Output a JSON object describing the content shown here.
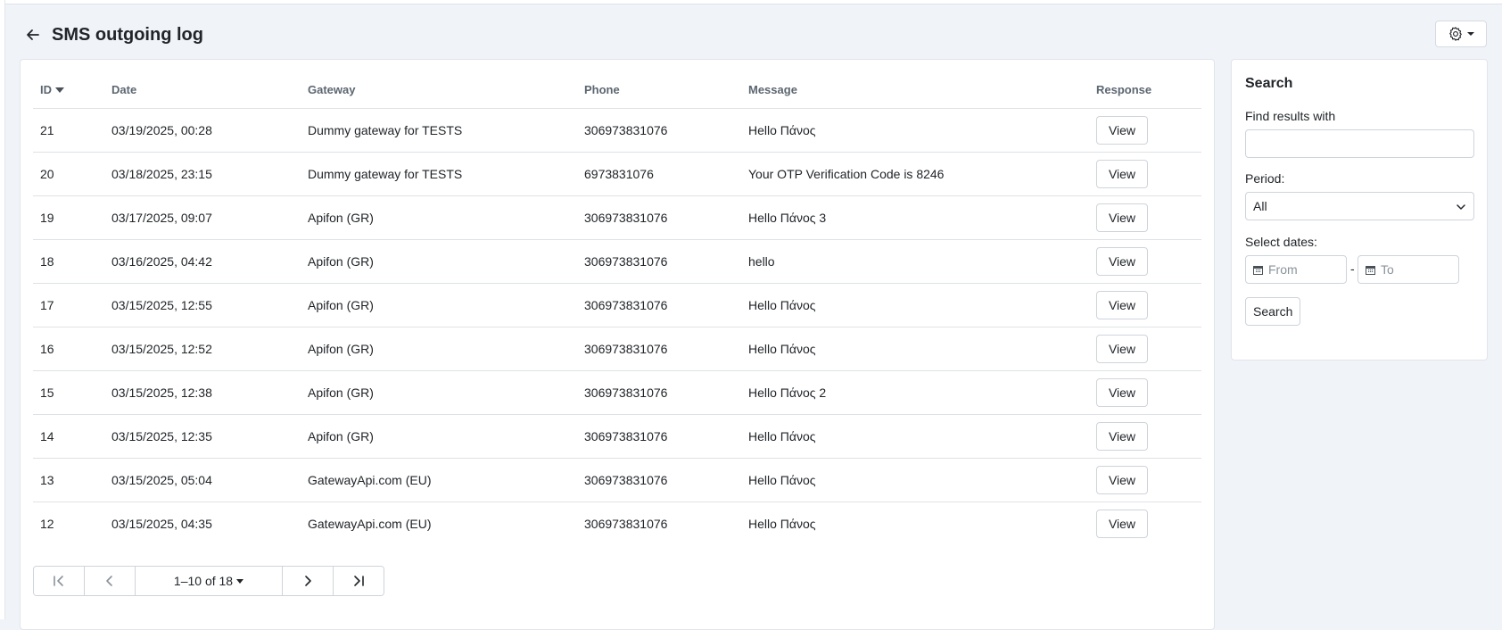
{
  "header": {
    "title": "SMS outgoing log"
  },
  "table": {
    "columns": {
      "id": "ID",
      "date": "Date",
      "gateway": "Gateway",
      "phone": "Phone",
      "message": "Message",
      "response": "Response"
    },
    "rows": [
      {
        "id": "21",
        "date": "03/19/2025, 00:28",
        "gateway": "Dummy gateway for TESTS",
        "phone": "306973831076",
        "message": "Hello Πάνος",
        "action": "View"
      },
      {
        "id": "20",
        "date": "03/18/2025, 23:15",
        "gateway": "Dummy gateway for TESTS",
        "phone": "6973831076",
        "message": "Your OTP Verification Code is 8246",
        "action": "View"
      },
      {
        "id": "19",
        "date": "03/17/2025, 09:07",
        "gateway": "Apifon (GR)",
        "phone": "306973831076",
        "message": "Hello Πάνος 3",
        "action": "View"
      },
      {
        "id": "18",
        "date": "03/16/2025, 04:42",
        "gateway": "Apifon (GR)",
        "phone": "306973831076",
        "message": "hello",
        "action": "View"
      },
      {
        "id": "17",
        "date": "03/15/2025, 12:55",
        "gateway": "Apifon (GR)",
        "phone": "306973831076",
        "message": "Hello Πάνος",
        "action": "View"
      },
      {
        "id": "16",
        "date": "03/15/2025, 12:52",
        "gateway": "Apifon (GR)",
        "phone": "306973831076",
        "message": "Hello Πάνος",
        "action": "View"
      },
      {
        "id": "15",
        "date": "03/15/2025, 12:38",
        "gateway": "Apifon (GR)",
        "phone": "306973831076",
        "message": "Hello Πάνος 2",
        "action": "View"
      },
      {
        "id": "14",
        "date": "03/15/2025, 12:35",
        "gateway": "Apifon (GR)",
        "phone": "306973831076",
        "message": "Hello Πάνος",
        "action": "View"
      },
      {
        "id": "13",
        "date": "03/15/2025, 05:04",
        "gateway": "GatewayApi.com (EU)",
        "phone": "306973831076",
        "message": "Hello Πάνος",
        "action": "View"
      },
      {
        "id": "12",
        "date": "03/15/2025, 04:35",
        "gateway": "GatewayApi.com (EU)",
        "phone": "306973831076",
        "message": "Hello Πάνος",
        "action": "View"
      }
    ]
  },
  "pagination": {
    "range": "1–10 of 18"
  },
  "search": {
    "title": "Search",
    "find_label": "Find results with",
    "find_value": "",
    "period_label": "Period:",
    "period_value": "All",
    "dates_label": "Select dates:",
    "from_placeholder": "From",
    "to_placeholder": "To",
    "date_separator": "-",
    "button_label": "Search"
  },
  "icons": {
    "back": "arrow-left-icon",
    "settings": "gear-icon",
    "calendar": "calendar-icon"
  },
  "colors": {
    "background": "#f0f3f7",
    "card": "#ffffff",
    "border": "#dee2e6",
    "text": "#212529",
    "muted": "#5c6670"
  }
}
